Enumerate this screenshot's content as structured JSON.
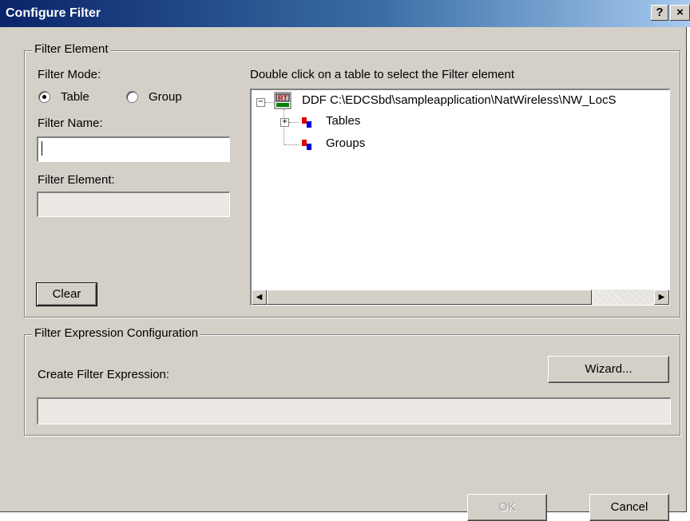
{
  "window": {
    "title": "Configure Filter",
    "help_button": "?",
    "close_button": "×"
  },
  "filter_element_group": {
    "legend": "Filter Element",
    "mode_label": "Filter Mode:",
    "mode_options": [
      {
        "label": "Table",
        "selected": true
      },
      {
        "label": "Group",
        "selected": false
      }
    ],
    "name_label": "Filter Name:",
    "name_value": "",
    "element_label": "Filter Element:",
    "element_value": "",
    "clear_label": "Clear",
    "tree_instruction": "Double click on a table to select the Filter element",
    "tree": {
      "root": {
        "label": "DDF C:\\EDCSbd\\sampleapplication\\NatWireless\\NW_LocS",
        "icon": "ddf-database-icon",
        "expanded": true
      },
      "children": [
        {
          "label": "Tables",
          "icon": "table-node-icon",
          "expandable": true
        },
        {
          "label": "Groups",
          "icon": "group-node-icon",
          "expandable": false
        }
      ]
    }
  },
  "expression_group": {
    "legend": "Filter Expression Configuration",
    "create_label": "Create Filter Expression:",
    "wizard_label": "Wizard...",
    "expression_value": ""
  },
  "footer": {
    "ok_label": "OK",
    "cancel_label": "Cancel"
  },
  "colors": {
    "title_bar_start": "#0a246a",
    "title_bar_end": "#a6caf0",
    "dialog_face": "#d4d0c8"
  }
}
